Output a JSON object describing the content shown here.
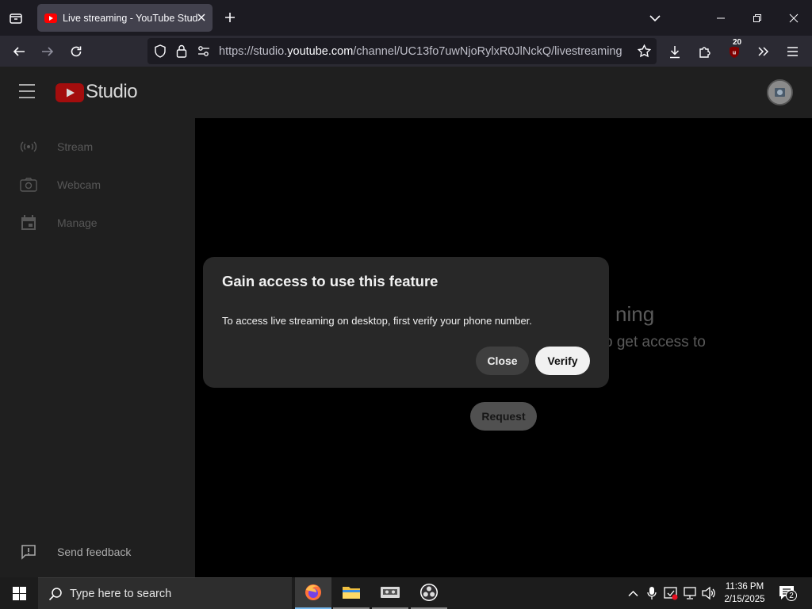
{
  "browser": {
    "tab_title": "Live streaming - YouTube Studio",
    "url_prefix": "https://studio.",
    "url_domain": "youtube.com",
    "url_path": "/channel/UC13fo7uwNjoRylxR0JlNckQ/livestreaming",
    "extension_badge": "20"
  },
  "studio": {
    "logo_text": "Studio",
    "sidebar": [
      {
        "label": "Stream",
        "icon": "stream-icon"
      },
      {
        "label": "Webcam",
        "icon": "webcam-icon"
      },
      {
        "label": "Manage",
        "icon": "calendar-icon"
      }
    ],
    "feedback_label": "Send feedback",
    "background_heading": "ning",
    "background_sub": "o get access to",
    "request_label": "Request"
  },
  "dialog": {
    "title": "Gain access to use this feature",
    "body": "To access live streaming on desktop, first verify your phone number.",
    "close_label": "Close",
    "verify_label": "Verify"
  },
  "taskbar": {
    "search_placeholder": "Type here to search",
    "time": "11:36 PM",
    "date": "2/15/2025",
    "notification_count": "2"
  },
  "colors": {
    "youtube_red": "#ff0000",
    "taskbar_accent": "#76b9ed"
  }
}
